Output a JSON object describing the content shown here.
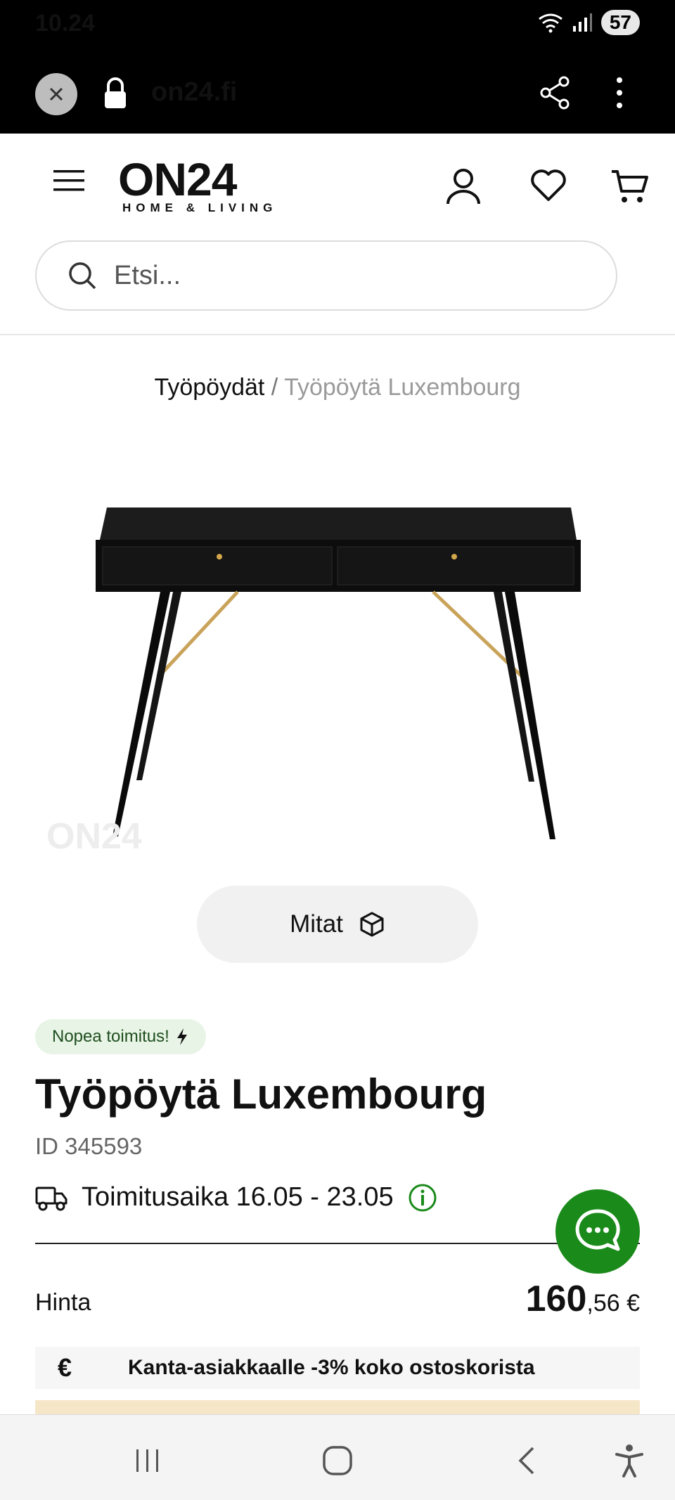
{
  "status_bar": {
    "time": "10.24",
    "battery": "57"
  },
  "browser": {
    "url": "on24.fi"
  },
  "header": {
    "logo_main": "ON24",
    "logo_sub": "HOME & LIVING",
    "search_placeholder": "Etsi..."
  },
  "breadcrumb": {
    "parent": "Työpöydät",
    "separator": "/",
    "current": "Työpöytä Luxembourg"
  },
  "product": {
    "watermark": "ON24",
    "dimensions_button": "Mitat",
    "badge": "Nopea toimitus!",
    "title": "Työpöytä Luxembourg",
    "id": "ID 345593",
    "delivery": "Toimitusaika 16.05 - 23.05",
    "price_label": "Hinta",
    "price_main": "160",
    "price_cents": ",56 €",
    "promo_symbol": "€",
    "promo_text": "Kanta-asiakkaalle -3% koko ostoskorista"
  },
  "colors": {
    "accent_green": "#1a8a1a",
    "badge_bg": "#e8f5e6",
    "muted": "#9a9a9a"
  },
  "icons": [
    "close-icon",
    "lock-icon",
    "share-icon",
    "more-vertical-icon",
    "hamburger-icon",
    "user-icon",
    "heart-icon",
    "cart-icon",
    "search-icon",
    "cube-icon",
    "lightning-icon",
    "truck-icon",
    "info-icon",
    "chat-icon",
    "euro-icon",
    "recent-apps-icon",
    "home-icon",
    "back-icon",
    "accessibility-icon"
  ]
}
